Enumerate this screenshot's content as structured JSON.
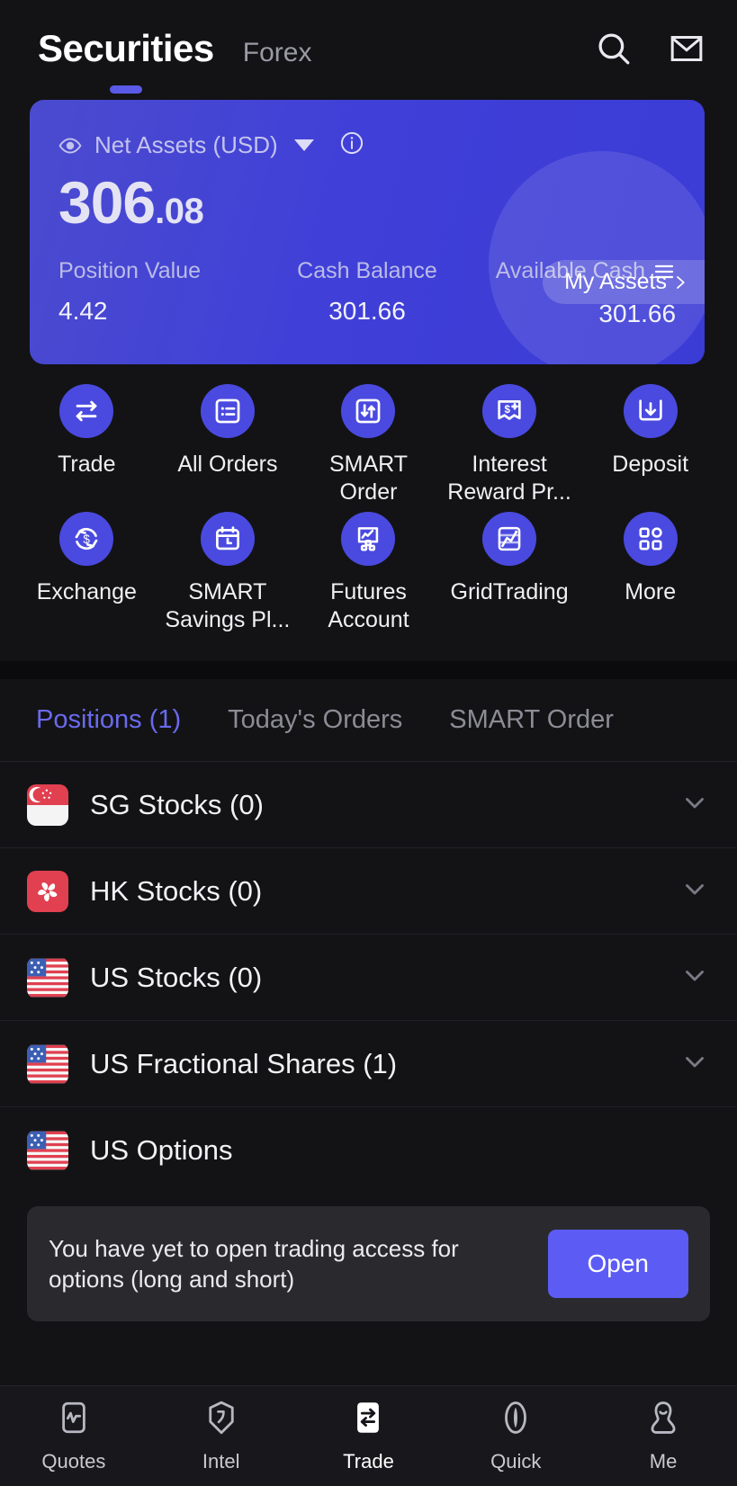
{
  "header": {
    "title": "Securities",
    "alt_tab": "Forex",
    "search_icon": "search-icon",
    "mail_icon": "mail-icon"
  },
  "asset_card": {
    "eye_icon": "eye-icon",
    "label": "Net Assets (USD)",
    "caret_icon": "chevron-down-icon",
    "info_icon": "info-icon",
    "amount_int": "306",
    "amount_dec": ".08",
    "my_assets": "My Assets",
    "my_assets_chevron": "chevron-right-icon",
    "stats": [
      {
        "label": "Position Value",
        "value": "4.42"
      },
      {
        "label": "Cash Balance",
        "value": "301.66"
      },
      {
        "label": "Available Cash",
        "value": "301.66"
      }
    ],
    "hamburger_icon": "hamburger-icon",
    "accent": "#4040d8"
  },
  "actions": [
    {
      "label": "Trade",
      "icon": "swap-arrows-icon"
    },
    {
      "label": "All Orders",
      "icon": "list-icon"
    },
    {
      "label": "SMART Order",
      "icon": "up-down-arrows-box-icon"
    },
    {
      "label": "Interest Reward Pr...",
      "icon": "dollar-plus-banner-icon"
    },
    {
      "label": "Deposit",
      "icon": "download-box-icon"
    },
    {
      "label": "Exchange",
      "icon": "dollar-refresh-icon"
    },
    {
      "label": "SMART Savings Pl...",
      "icon": "calendar-clock-icon"
    },
    {
      "label": "Futures Account",
      "icon": "chart-blocks-icon"
    },
    {
      "label": "GridTrading",
      "icon": "grid-chart-icon"
    },
    {
      "label": "More",
      "icon": "apps-grid-icon"
    }
  ],
  "tabs": [
    {
      "label": "Positions (1)",
      "active": true
    },
    {
      "label": "Today's Orders",
      "active": false
    },
    {
      "label": "SMART Order",
      "active": false
    }
  ],
  "positions": [
    {
      "label": "SG Stocks (0)",
      "flag": "sg-flag-icon",
      "chevron": "chevron-down-icon"
    },
    {
      "label": "HK Stocks (0)",
      "flag": "hk-flag-icon",
      "chevron": "chevron-down-icon"
    },
    {
      "label": "US Stocks (0)",
      "flag": "us-flag-icon",
      "chevron": "chevron-down-icon"
    },
    {
      "label": "US Fractional Shares (1)",
      "flag": "us-flag-icon",
      "chevron": "chevron-down-icon"
    },
    {
      "label": "US Options",
      "flag": "us-flag-icon",
      "chevron": ""
    }
  ],
  "notice": {
    "text": "You have yet to open trading access for options (long and short)",
    "button": "Open",
    "button_color": "#5c5cf5"
  },
  "bottom_nav": [
    {
      "label": "Quotes",
      "icon": "quotes-icon",
      "active": false
    },
    {
      "label": "Intel",
      "icon": "intel-icon",
      "active": false
    },
    {
      "label": "Trade",
      "icon": "trade-swap-icon",
      "active": true
    },
    {
      "label": "Quick",
      "icon": "quick-lens-icon",
      "active": false
    },
    {
      "label": "Me",
      "icon": "person-icon",
      "active": false
    }
  ]
}
